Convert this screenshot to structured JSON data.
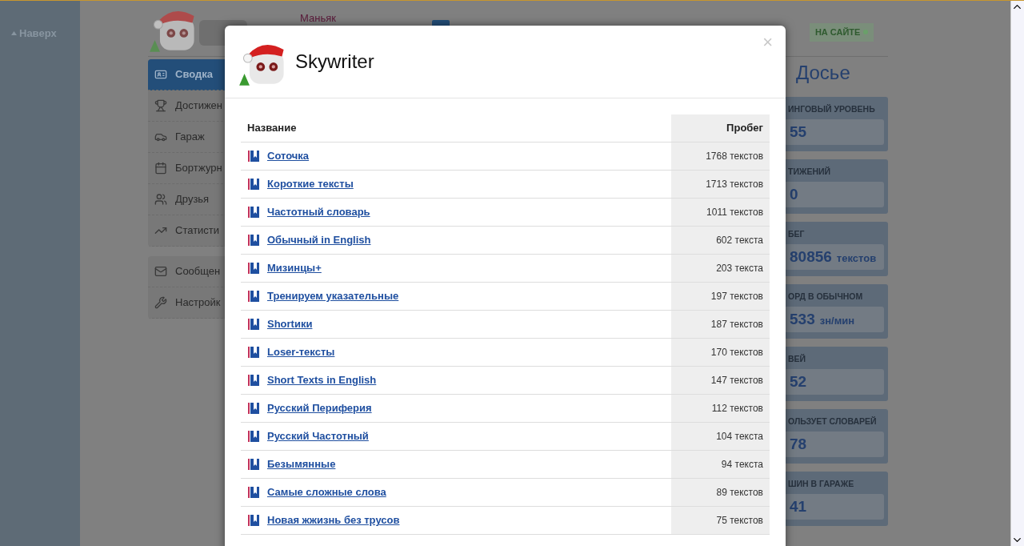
{
  "sidebar": {
    "back_link": "Наверх"
  },
  "profile": {
    "rank": "Маньяк",
    "status": "НА САЙТЕ"
  },
  "menu_groups": [
    {
      "items": [
        {
          "label": "Сводка",
          "kind": "profile",
          "selected": true
        },
        {
          "label": "Достижен",
          "kind": "trophy",
          "selected": false
        },
        {
          "label": "Гараж",
          "kind": "car",
          "selected": false
        },
        {
          "label": "Бортжурн",
          "kind": "calendar",
          "selected": false
        },
        {
          "label": "Друзья",
          "kind": "friends",
          "selected": false
        },
        {
          "label": "Статисти",
          "kind": "chart",
          "selected": false
        }
      ]
    },
    {
      "items": [
        {
          "label": "Сообщен",
          "kind": "mail",
          "selected": false
        },
        {
          "label": "Настройк",
          "kind": "wrench",
          "selected": false
        }
      ]
    }
  ],
  "dossier": {
    "title": "Досье",
    "stats": [
      {
        "label": "ИНГОВЫЙ УРОВЕНЬ",
        "value": "55"
      },
      {
        "label": "ТИЖЕНИЙ",
        "value": "0"
      },
      {
        "label": "БЕГ",
        "value": "80856",
        "unit": "текстов"
      },
      {
        "label": "ОРД В ОБЫЧНОМ",
        "value": "533",
        "unit": "зн/мин"
      },
      {
        "label": "ВЕЙ",
        "value": "52"
      },
      {
        "label": "ОЛЬЗУЕТ СЛОВАРЕЙ",
        "value": "78"
      },
      {
        "label": "ШИН В ГАРАЖЕ",
        "value": "41"
      }
    ]
  },
  "modal": {
    "title": "Skywriter",
    "close": "×",
    "columns": [
      "Название",
      "Пробег"
    ],
    "rows": [
      {
        "name": "Соточка",
        "mileage": "1768 текстов"
      },
      {
        "name": "Короткие тексты",
        "mileage": "1713 текстов"
      },
      {
        "name": "Частотный словарь",
        "mileage": "1011 текстов"
      },
      {
        "name": "Обычный in English",
        "mileage": "602 текста"
      },
      {
        "name": "Мизинцы+",
        "mileage": "203 текста"
      },
      {
        "name": "Тренируем указательные",
        "mileage": "197 текстов"
      },
      {
        "name": "Shortики",
        "mileage": "187 текстов"
      },
      {
        "name": "Loser-тексты",
        "mileage": "170 текстов"
      },
      {
        "name": "Short Texts in English",
        "mileage": "147 текстов"
      },
      {
        "name": "Русский Периферия",
        "mileage": "112 текстов"
      },
      {
        "name": "Русский Частотный",
        "mileage": "104 текста"
      },
      {
        "name": "Безымянные",
        "mileage": "94 текста"
      },
      {
        "name": "Самые сложные слова",
        "mileage": "89 текстов"
      },
      {
        "name": "Новая жжизнь без трусов",
        "mileage": "75 текстов"
      }
    ]
  }
}
